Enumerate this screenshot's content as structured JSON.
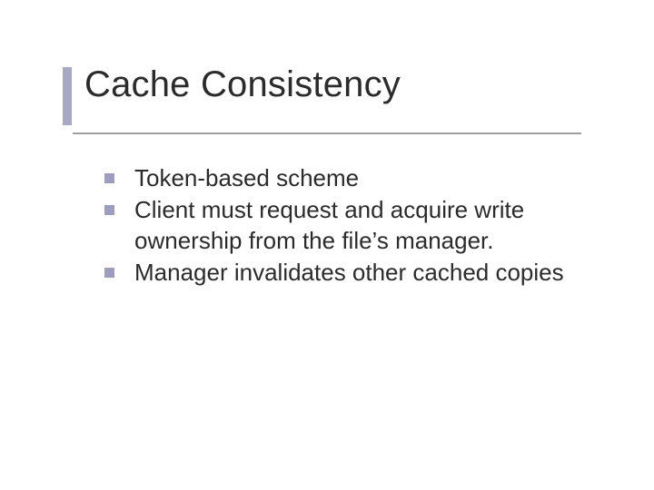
{
  "slide": {
    "title": "Cache Consistency",
    "bullets": [
      "Token-based scheme",
      "Client must request and acquire write ownership from the file’s manager.",
      "Manager invalidates other cached copies"
    ]
  }
}
